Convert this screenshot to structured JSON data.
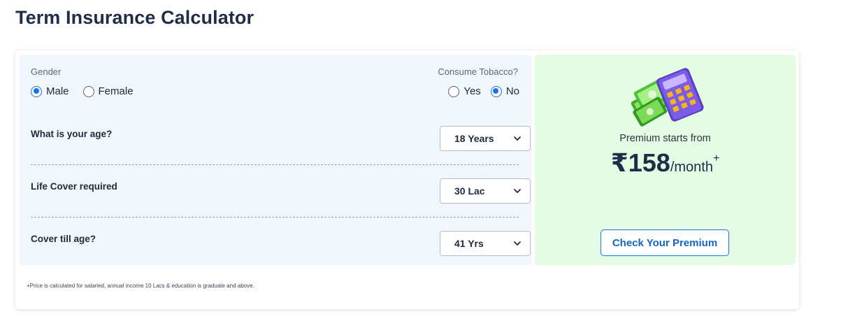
{
  "page": {
    "title": "Term Insurance Calculator"
  },
  "form": {
    "gender": {
      "label": "Gender",
      "options": [
        {
          "label": "Male",
          "checked": true
        },
        {
          "label": "Female",
          "checked": false
        }
      ]
    },
    "tobacco": {
      "label": "Consume Tobacco?",
      "options": [
        {
          "label": "Yes",
          "checked": false
        },
        {
          "label": "No",
          "checked": true
        }
      ]
    },
    "questions": [
      {
        "label": "What is your age?",
        "value": "18 Years"
      },
      {
        "label": "Life Cover required",
        "value": "30 Lac"
      },
      {
        "label": "Cover till age?",
        "value": "41 Yrs"
      }
    ]
  },
  "premium": {
    "caption": "Premium starts from",
    "amount": "₹158",
    "unit": "/month",
    "marker": "+",
    "cta_label": "Check Your Premium"
  },
  "footnote": "+Price is calculated for salaried, annual income 10 Lacs & education is graduate and above.",
  "icons": {
    "select_arrow": "chevron-down-icon",
    "illustration": "calculator-money-icon"
  },
  "colors": {
    "accent": "#1a73e8",
    "form_bg": "#f2f6fd",
    "premium_bg": "#e4fbe4",
    "title": "#1f2d47"
  }
}
